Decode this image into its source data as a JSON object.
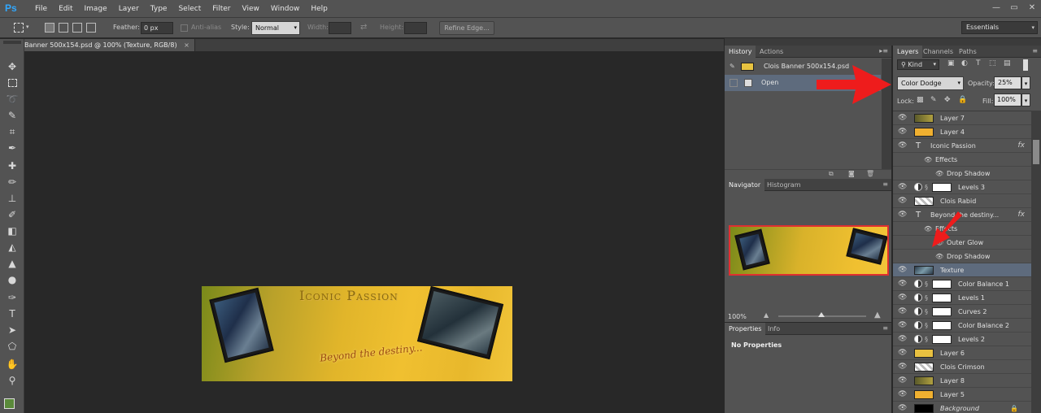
{
  "menubar": {
    "logo": "Ps",
    "items": [
      "File",
      "Edit",
      "Image",
      "Layer",
      "Type",
      "Select",
      "Filter",
      "View",
      "Window",
      "Help"
    ],
    "window_controls": [
      "—",
      "▭",
      "✕"
    ]
  },
  "options": {
    "feather_label": "Feather:",
    "feather_value": "0 px",
    "antialias_label": "Anti-alias",
    "style_label": "Style:",
    "style_value": "Normal",
    "width_label": "Width:",
    "height_label": "Height:",
    "refine_edge": "Refine Edge...",
    "workspace": "Essentials"
  },
  "document": {
    "tab_title": "Banner 500x154.psd @ 100% (Texture, RGB/8)",
    "close": "×"
  },
  "banner": {
    "title": "Iconic Passion",
    "tagline": "Beyond the destiny..."
  },
  "history": {
    "tabs": [
      "History",
      "Actions"
    ],
    "snapshot": "Clois Banner 500x154.psd",
    "rows": [
      "Open"
    ]
  },
  "navigator": {
    "tabs": [
      "Navigator",
      "Histogram"
    ],
    "zoom": "100%"
  },
  "properties": {
    "tabs": [
      "Properties",
      "Info"
    ],
    "status": "No Properties"
  },
  "layers_panel": {
    "tabs": [
      "Layers",
      "Channels",
      "Paths"
    ],
    "filter_kind": "Kind",
    "blend_mode": "Color Dodge",
    "opacity_label": "Opacity:",
    "opacity_value": "25%",
    "lock_label": "Lock:",
    "fill_label": "Fill:",
    "fill_value": "100%",
    "layers": [
      {
        "name": "Layer 7",
        "kind": "pixel",
        "thumb": "#8a8a3a"
      },
      {
        "name": "Layer 4",
        "kind": "pixel",
        "thumb": "#f0b030"
      },
      {
        "name": "Iconic Passion",
        "kind": "text",
        "fx": true
      },
      {
        "name": "Effects",
        "kind": "effects"
      },
      {
        "name": "Drop Shadow",
        "kind": "effect"
      },
      {
        "name": "Levels 3",
        "kind": "adjust"
      },
      {
        "name": "Clois Rabid",
        "kind": "checker"
      },
      {
        "name": "Beyond the destiny...",
        "kind": "text",
        "fx": true
      },
      {
        "name": "Effects",
        "kind": "effects"
      },
      {
        "name": "Outer Glow",
        "kind": "effect"
      },
      {
        "name": "Drop Shadow",
        "kind": "effect"
      },
      {
        "name": "Texture",
        "kind": "pixel",
        "thumb": "#4a6a7a",
        "selected": true
      },
      {
        "name": "Color Balance 1",
        "kind": "adjust"
      },
      {
        "name": "Levels 1",
        "kind": "adjust"
      },
      {
        "name": "Curves 2",
        "kind": "adjust"
      },
      {
        "name": "Color Balance 2",
        "kind": "adjust"
      },
      {
        "name": "Levels 2",
        "kind": "adjust"
      },
      {
        "name": "Layer 6",
        "kind": "pixel",
        "thumb": "#e8c040"
      },
      {
        "name": "Clois Crimson",
        "kind": "checker"
      },
      {
        "name": "Layer 8",
        "kind": "pixel",
        "thumb": "#8a8a3a"
      },
      {
        "name": "Layer 5",
        "kind": "pixel",
        "thumb": "#f0b030"
      },
      {
        "name": "Background",
        "kind": "background",
        "thumb": "#000000"
      }
    ]
  },
  "colors": {
    "accent_arrow": "#ee1c1c",
    "selected_row": "#5e6b7d",
    "foreground_swatch": "#5a8a3a",
    "background_swatch": "#cc2222"
  }
}
